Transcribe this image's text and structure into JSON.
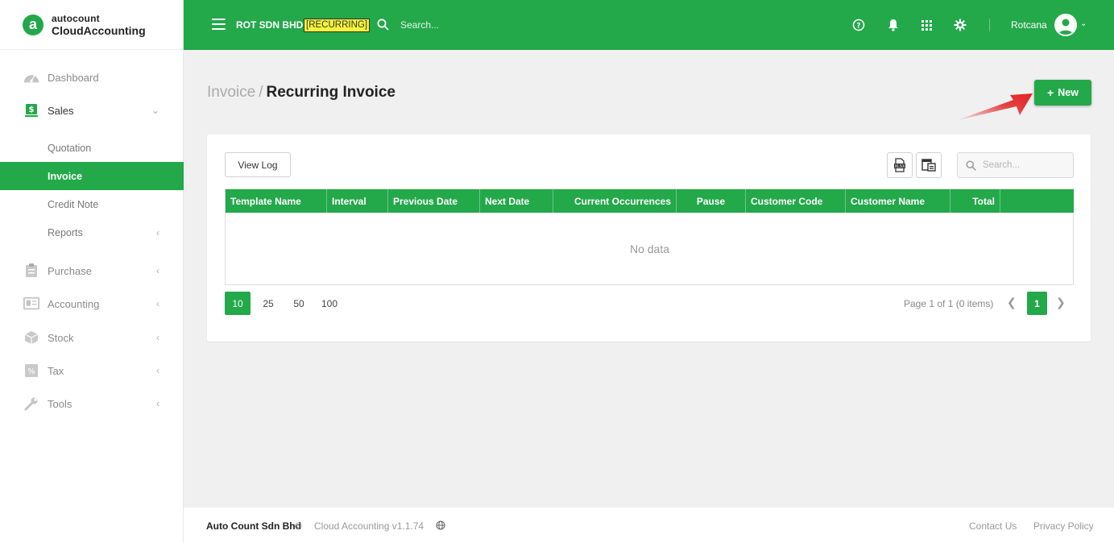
{
  "brand": {
    "top": "autocount",
    "bottom": "CloudAccounting",
    "badge": "a"
  },
  "sidebar": {
    "items": [
      {
        "label": "Dashboard",
        "icon": "dashboard-icon"
      },
      {
        "label": "Sales",
        "icon": "sales-icon",
        "expanded": true
      },
      {
        "label": "Quotation"
      },
      {
        "label": "Invoice",
        "active": true
      },
      {
        "label": "Credit Note"
      },
      {
        "label": "Reports"
      },
      {
        "label": "Purchase",
        "icon": "purchase-icon"
      },
      {
        "label": "Accounting",
        "icon": "accounting-icon"
      },
      {
        "label": "Stock",
        "icon": "stock-icon"
      },
      {
        "label": "Tax",
        "icon": "tax-icon"
      },
      {
        "label": "Tools",
        "icon": "tools-icon"
      }
    ]
  },
  "topbar": {
    "company": "ROT SDN BHD",
    "badge": "[RECURRING]",
    "search_placeholder": "Search...",
    "username": "Rotcana"
  },
  "breadcrumb": {
    "parent": "Invoice",
    "separator": "/",
    "current": "Recurring Invoice"
  },
  "new_button": {
    "label": "New",
    "plus": "+"
  },
  "toolbar": {
    "view_log": "View Log",
    "search_placeholder": "Search..."
  },
  "table": {
    "columns": [
      "Template Name",
      "Interval",
      "Previous Date",
      "Next Date",
      "Current Occurrences",
      "Pause",
      "Customer Code",
      "Customer Name",
      "Total"
    ],
    "rows": [],
    "empty_text": "No data"
  },
  "pager": {
    "page_sizes": [
      "10",
      "25",
      "50",
      "100"
    ],
    "selected_size": "10",
    "info": "Page 1 of 1 (0 items)",
    "current_page": "1"
  },
  "footer": {
    "company": "Auto Count Sdn Bhd",
    "copyright": "©",
    "version": "Cloud Accounting v1.1.74",
    "contact": "Contact Us",
    "privacy": "Privacy Policy"
  },
  "colors": {
    "accent": "#23a84a",
    "badge_bg": "#f4f43a",
    "arrow": "#e32222"
  }
}
